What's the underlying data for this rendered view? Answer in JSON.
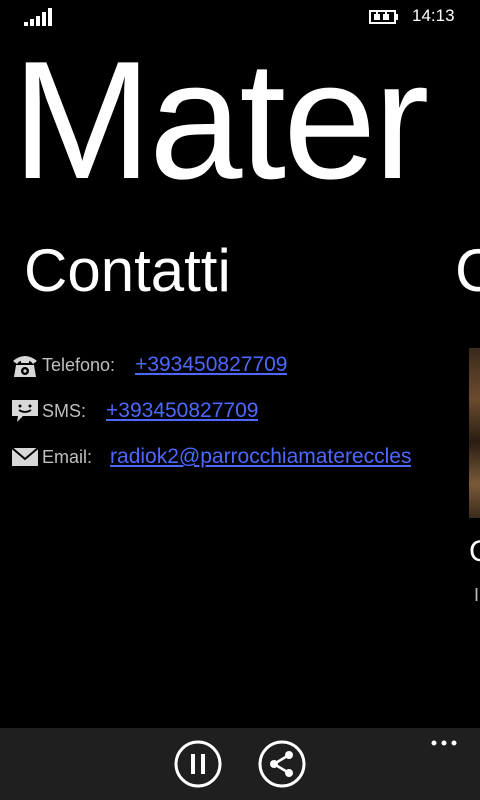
{
  "status_bar": {
    "time": "14:13",
    "signal_icon": "signal-bars-icon",
    "battery_icon": "battery-charging-icon"
  },
  "app": {
    "title": "Mater"
  },
  "section": {
    "title": "Contatti",
    "next_section_initial": "C"
  },
  "contacts": {
    "phone": {
      "icon": "telephone-icon",
      "label": "Telefono:",
      "value": "+393450827709"
    },
    "sms": {
      "icon": "sms-chat-icon",
      "label": "SMS:",
      "value": "+393450827709"
    },
    "email": {
      "icon": "envelope-icon",
      "label": "Email:",
      "value": "radiok2@parrocchiamatereccles"
    }
  },
  "peek": {
    "heading_initial": "C",
    "sub_initial": "I"
  },
  "app_bar": {
    "buttons": [
      {
        "icon": "pause-icon"
      },
      {
        "icon": "share-icon"
      }
    ],
    "more_icon": "ellipsis-icon"
  },
  "colors": {
    "background": "#000000",
    "link": "#4c68ff",
    "label": "#bfbfbf",
    "app_bar": "#1f1f1f"
  }
}
